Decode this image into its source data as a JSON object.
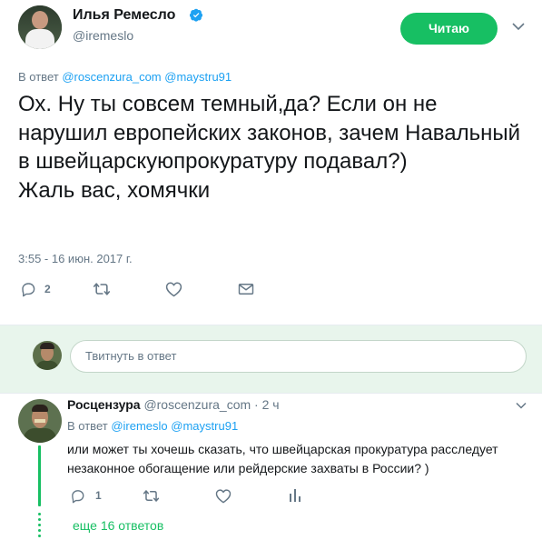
{
  "main_tweet": {
    "author_name": "Илья Ремесло",
    "author_handle": "@iremeslo",
    "follow_label": "Читаю",
    "reply_prefix": "В ответ",
    "reply_mentions": [
      "@roscenzura_com",
      "@maystru91"
    ],
    "text": "Ох. Ну ты совсем темный,да? Если он не нарушил европейских законов, зачем Навальный в швейцарскуюпрокуратуру подавал?)\nЖаль вас, хомячки",
    "timestamp": "3:55 - 16 июн. 2017 г.",
    "reply_count": "2",
    "icons": [
      "reply-icon",
      "retweet-icon",
      "like-icon",
      "direct-message-icon"
    ],
    "verified": true
  },
  "reply_box": {
    "placeholder": "Твитнуть в ответ"
  },
  "reply_tweet": {
    "author_name": "Росцензура",
    "author_handle": "@roscenzura_com",
    "separator": "·",
    "time": "2 ч",
    "reply_prefix": "В ответ",
    "reply_mentions": [
      "@iremeslo",
      "@maystru91"
    ],
    "text": "или может ты хочешь сказать, что швейцарская прокуратура расследует незаконное обогащение или рейдерские захваты в России? )",
    "reply_count": "1",
    "icons": [
      "reply-icon",
      "retweet-icon",
      "like-icon",
      "analytics-icon"
    ]
  },
  "more_replies_label": "еще 16 ответов",
  "colors": {
    "accent_green": "#17bf63",
    "link_blue": "#1da1f2",
    "muted": "#657786",
    "reply_bar_bg": "#e8f5ec"
  }
}
